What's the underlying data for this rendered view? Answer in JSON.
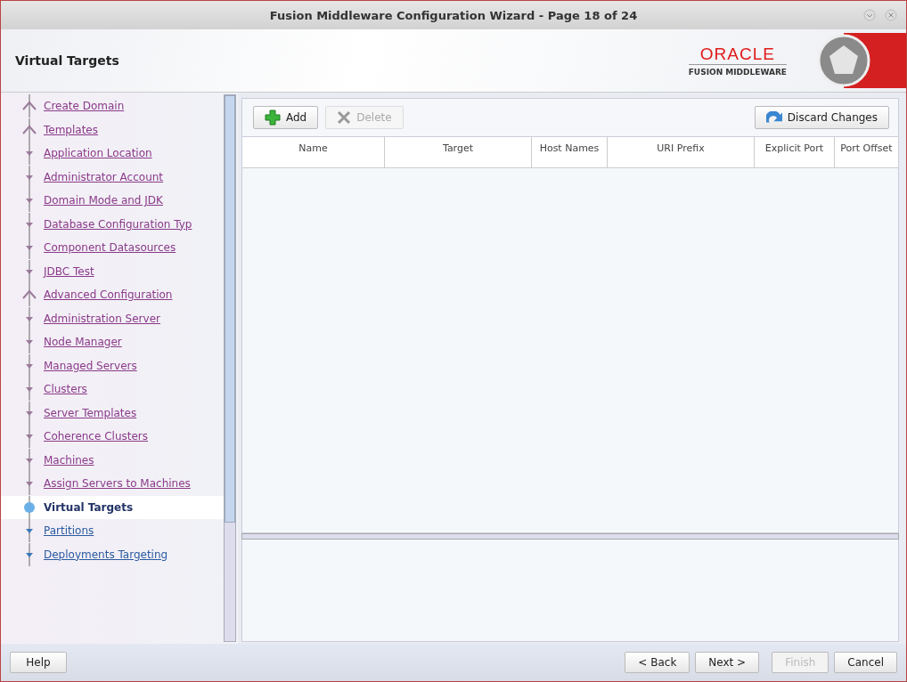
{
  "window": {
    "title": "Fusion Middleware Configuration Wizard - Page 18 of 24"
  },
  "header": {
    "page_title": "Virtual Targets",
    "brand": "ORACLE",
    "product": "FUSION MIDDLEWARE"
  },
  "steps": [
    {
      "label": "Create Domain",
      "kind": "section",
      "visited": true,
      "selected": false
    },
    {
      "label": "Templates",
      "kind": "section",
      "visited": true,
      "selected": false
    },
    {
      "label": "Application Location",
      "kind": "step",
      "visited": true,
      "selected": false
    },
    {
      "label": "Administrator Account",
      "kind": "step",
      "visited": true,
      "selected": false
    },
    {
      "label": "Domain Mode and JDK",
      "kind": "step",
      "visited": true,
      "selected": false
    },
    {
      "label": "Database Configuration Typ",
      "kind": "step",
      "visited": true,
      "selected": false
    },
    {
      "label": "Component Datasources",
      "kind": "step",
      "visited": true,
      "selected": false
    },
    {
      "label": "JDBC Test",
      "kind": "step",
      "visited": true,
      "selected": false
    },
    {
      "label": "Advanced Configuration",
      "kind": "section",
      "visited": true,
      "selected": false
    },
    {
      "label": "Administration Server",
      "kind": "step",
      "visited": true,
      "selected": false
    },
    {
      "label": "Node Manager",
      "kind": "step",
      "visited": true,
      "selected": false
    },
    {
      "label": "Managed Servers",
      "kind": "step",
      "visited": true,
      "selected": false
    },
    {
      "label": "Clusters",
      "kind": "step",
      "visited": true,
      "selected": false
    },
    {
      "label": "Server Templates",
      "kind": "step",
      "visited": true,
      "selected": false
    },
    {
      "label": "Coherence Clusters",
      "kind": "step",
      "visited": true,
      "selected": false
    },
    {
      "label": "Machines",
      "kind": "step",
      "visited": true,
      "selected": false
    },
    {
      "label": "Assign Servers to Machines",
      "kind": "step",
      "visited": true,
      "selected": false
    },
    {
      "label": "Virtual Targets",
      "kind": "step",
      "visited": false,
      "selected": true
    },
    {
      "label": "Partitions",
      "kind": "step",
      "visited": false,
      "selected": false
    },
    {
      "label": "Deployments Targeting",
      "kind": "step",
      "visited": false,
      "selected": false
    }
  ],
  "toolbar": [
    {
      "label": "Add",
      "kind": "add",
      "disabled": false
    },
    {
      "label": "Delete",
      "kind": "delete",
      "disabled": true
    },
    {
      "label": "Discard Changes",
      "kind": "discard",
      "disabled": false
    }
  ],
  "table": {
    "columns": [
      "Name",
      "Target",
      "Host Names",
      "URI Prefix",
      "Explicit Port",
      "Port Offset"
    ]
  },
  "buttons": [
    {
      "label": "Help",
      "kind": "help",
      "disabled": false
    },
    {
      "label": "< Back",
      "kind": "nav",
      "disabled": false
    },
    {
      "label": "Next >",
      "kind": "nav",
      "disabled": false
    },
    {
      "label": "Finish",
      "kind": "nav",
      "disabled": true
    },
    {
      "label": "Cancel",
      "kind": "cancel",
      "disabled": false
    }
  ]
}
